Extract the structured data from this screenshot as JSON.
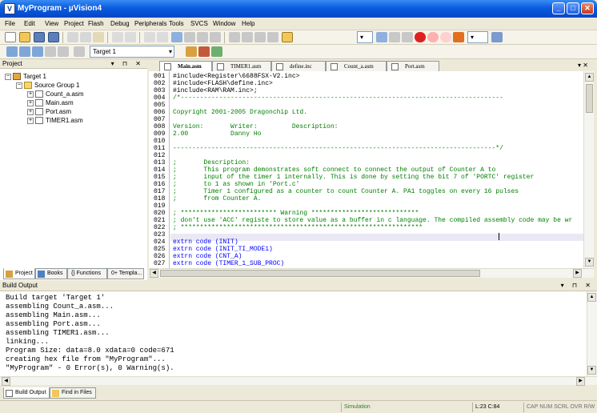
{
  "window": {
    "title": "MyProgram - µVision4",
    "minimize": "_",
    "maximize": "□",
    "close": "✕"
  },
  "menu": [
    "File",
    "Edit",
    "View",
    "Project",
    "Flash",
    "Debug",
    "Peripherals",
    "Tools",
    "SVCS",
    "Window",
    "Help"
  ],
  "toolbar": {
    "target_combo": "Target 1"
  },
  "project_panel": {
    "title": "Project",
    "controls": "▾ ⊓ ✕",
    "tree": {
      "target": "Target 1",
      "group": "Source Group 1",
      "files": [
        "Count_a.asm",
        "Main.asm",
        "Port.asm",
        "TIMER1.asm"
      ]
    },
    "tabs": [
      "Project",
      "Books",
      "{} Functions",
      "0+ Templa..."
    ]
  },
  "editor": {
    "tabs": [
      "Main.asm",
      "TIMER1.asm",
      "define.inc",
      "Count_a.asm",
      "Port.asm"
    ],
    "active_tab": "Main.asm",
    "lines": [
      {
        "n": "001",
        "t": "#include<Register\\6688FSX-V2.inc>",
        "c": "prep"
      },
      {
        "n": "002",
        "t": "#include<FLASH\\define.inc>",
        "c": "prep"
      },
      {
        "n": "003",
        "t": "#include<RAM\\RAM.inc>;",
        "c": "prep"
      },
      {
        "n": "004",
        "t": "/*------------------------------------------------------------------------------------",
        "c": "cmt"
      },
      {
        "n": "005",
        "t": "",
        "c": "cmt"
      },
      {
        "n": "006",
        "t": "Copyright 2001-2005 Dragonchip Ltd.",
        "c": "cmt"
      },
      {
        "n": "007",
        "t": "",
        "c": "cmt"
      },
      {
        "n": "008",
        "t": "Version:       Writer:         Description:",
        "c": "cmt"
      },
      {
        "n": "009",
        "t": "2.00           Danny Ho",
        "c": "cmt"
      },
      {
        "n": "010",
        "t": "",
        "c": "cmt"
      },
      {
        "n": "011",
        "t": "------------------------------------------------------------------------------------*/",
        "c": "cmt"
      },
      {
        "n": "012",
        "t": "",
        "c": "cmt"
      },
      {
        "n": "013",
        "t": ";       Description:",
        "c": "cmt"
      },
      {
        "n": "014",
        "t": ";       This program demonstrates soft connect to connect the output of Counter A to",
        "c": "cmt"
      },
      {
        "n": "015",
        "t": ";       input of the timer 1 internally. This is done by setting the bit 7 of 'PORTC' register",
        "c": "cmt"
      },
      {
        "n": "016",
        "t": ";       to 1 as shown in 'Port.c'",
        "c": "cmt"
      },
      {
        "n": "017",
        "t": ";       Timer 1 configured as a counter to count Counter A. PA1 toggles on every 16 pulses",
        "c": "cmt"
      },
      {
        "n": "018",
        "t": ";       from Counter A.",
        "c": "cmt"
      },
      {
        "n": "019",
        "t": "",
        "c": "cmt"
      },
      {
        "n": "020",
        "t": "; ************************* Warning ****************************",
        "c": "cmt"
      },
      {
        "n": "021",
        "t": "; don't use 'ACC' registe to store value as a buffer in c language. The compiled assembly code may be wr",
        "c": "cmt"
      },
      {
        "n": "022",
        "t": "; ***************************************************************",
        "c": "cmt"
      },
      {
        "n": "023",
        "t": "",
        "c": "cmt"
      },
      {
        "n": "024",
        "t": "extrn code (INIT)",
        "c": "kw"
      },
      {
        "n": "025",
        "t": "extrn code (INIT_TI_MODE1)",
        "c": "kw"
      },
      {
        "n": "026",
        "t": "extrn code (CNT_A)",
        "c": "kw"
      },
      {
        "n": "027",
        "t": "extrn code (TIMER_1_SUB_PROC)",
        "c": "kw"
      }
    ]
  },
  "build_output": {
    "title": "Build Output",
    "controls": "▾ ⊓ ✕",
    "lines": [
      "Build target 'Target 1'",
      "assembling Count_a.asm...",
      "assembling Main.asm...",
      "assembling Port.asm...",
      "assembling TIMER1.asm...",
      "linking...",
      "Program Size: data=8.0 xdata=0 code=671",
      "creating hex file from \"MyProgram\"...",
      "\"MyProgram\" - 0 Error(s), 0 Warning(s)."
    ],
    "tabs": [
      "Build Output",
      "Find in Files"
    ]
  },
  "statusbar": {
    "mode": "Simulation",
    "position": "L:23 C:84",
    "indicators": "CAP  NUM  SCRL  OVR  R/W"
  },
  "colors": {
    "titlebar": "#0a5ce0",
    "code_comment": "#008000",
    "code_keyword": "#0000ff",
    "background": "#ece9d8"
  }
}
